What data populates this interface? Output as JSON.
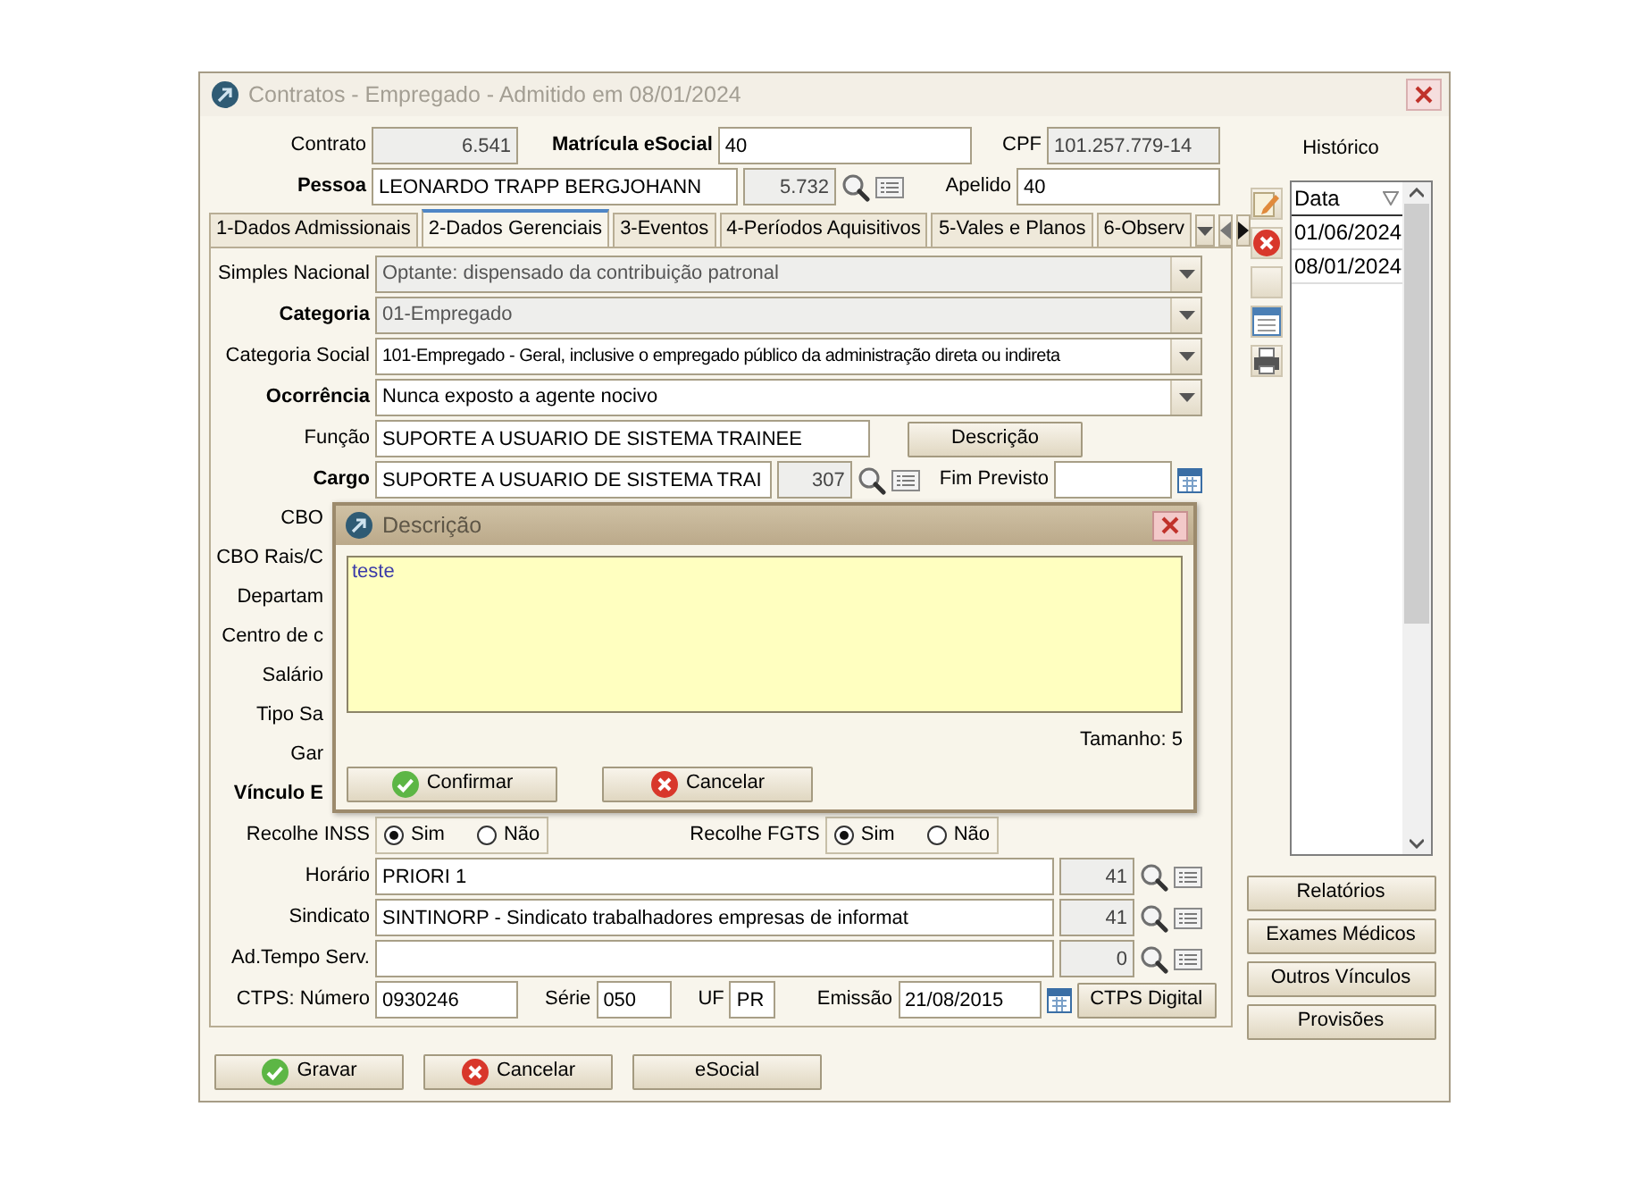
{
  "window": {
    "title": "Contratos - Empregado - Admitido em 08/01/2024"
  },
  "header": {
    "contrato": {
      "label": "Contrato",
      "bold": false,
      "value": "6.541",
      "disabled": true
    },
    "matricula": {
      "label": "Matrícula eSocial",
      "bold": true,
      "value": "40",
      "disabled": false
    },
    "cpf": {
      "label": "CPF",
      "bold": false,
      "value": "101.257.779-14",
      "disabled": true
    },
    "pessoa": {
      "label": "Pessoa",
      "bold": true,
      "value": "LEONARDO TRAPP BERGJOHANN",
      "code": "5.732"
    },
    "apelido": {
      "label": "Apelido",
      "bold": false,
      "value": "40",
      "disabled": false
    }
  },
  "tabs": [
    {
      "label": "1-Dados Admissionais",
      "selected": false
    },
    {
      "label": "2-Dados Gerenciais",
      "selected": true
    },
    {
      "label": "3-Eventos",
      "selected": false
    },
    {
      "label": "4-Períodos Aquisitivos",
      "selected": false
    },
    {
      "label": "5-Vales e Planos",
      "selected": false
    },
    {
      "label": "6-Observ",
      "selected": false
    }
  ],
  "form_rows": [
    {
      "kind": "combo",
      "label": "Simples Nacional",
      "bold": false,
      "value": "Optante: dispensado da contribuição patronal",
      "disabled": true
    },
    {
      "kind": "combo",
      "label": "Categoria",
      "bold": true,
      "value": "01-Empregado",
      "disabled": true
    },
    {
      "kind": "combo",
      "label": "Categoria Social",
      "bold": false,
      "value": "101-Empregado - Geral, inclusive o empregado público da administração direta ou indireta",
      "disabled": false
    },
    {
      "kind": "combo",
      "label": "Ocorrência",
      "bold": true,
      "value": "Nunca exposto a agente nocivo",
      "disabled": false
    },
    {
      "kind": "text_button",
      "label": "Função",
      "bold": false,
      "value": "SUPORTE A USUARIO DE SISTEMA TRAINEE",
      "button": "Descrição"
    },
    {
      "kind": "lookup_date",
      "label": "Cargo",
      "bold": true,
      "value": "SUPORTE A USUARIO DE SISTEMA TRAI",
      "code": "307",
      "date_label": "Fim Previsto"
    },
    {
      "kind": "covered",
      "label": "CBO",
      "bold": false
    },
    {
      "kind": "covered",
      "label": "CBO Rais/C",
      "bold": false
    },
    {
      "kind": "covered",
      "label": "Departam",
      "bold": false
    },
    {
      "kind": "covered",
      "label": "Centro de c",
      "bold": false
    },
    {
      "kind": "covered",
      "label": "Salário",
      "bold": false
    },
    {
      "kind": "covered",
      "label": "Tipo Sa",
      "bold": false
    },
    {
      "kind": "covered",
      "label": "Gar",
      "bold": false
    },
    {
      "kind": "covered",
      "label": "Vínculo E",
      "bold": true
    },
    {
      "kind": "radios",
      "groups": [
        {
          "label": "Recolhe INSS",
          "options": [
            {
              "label": "Sim",
              "selected": true
            },
            {
              "label": "Não",
              "selected": false
            }
          ]
        },
        {
          "label": "Recolhe FGTS",
          "options": [
            {
              "label": "Sim",
              "selected": true
            },
            {
              "label": "Não",
              "selected": false
            }
          ]
        }
      ]
    },
    {
      "kind": "lookup",
      "label": "Horário",
      "bold": false,
      "value": "PRIORI 1",
      "code": "41"
    },
    {
      "kind": "lookup",
      "label": "Sindicato",
      "bold": false,
      "value": "SINTINORP - Sindicato trabalhadores empresas de informat",
      "code": "41"
    },
    {
      "kind": "lookup",
      "label": "Ad.Tempo Serv.",
      "bold": false,
      "code": "0"
    },
    {
      "kind": "ctps",
      "label": "CTPS: Número",
      "bold": false,
      "value": "0930246",
      "fields": [
        {
          "label": "Série",
          "value": "050"
        },
        {
          "label": "UF",
          "value": "PR"
        },
        {
          "label": "Emissão",
          "value": "21/08/2015"
        }
      ],
      "button": "CTPS Digital"
    }
  ],
  "footer_buttons": [
    {
      "label": "Gravar",
      "kind": "confirm"
    },
    {
      "label": "Cancelar",
      "kind": "cancel"
    },
    {
      "label": "eSocial",
      "kind": "plain"
    }
  ],
  "historico": {
    "title": "Histórico",
    "column": "Data",
    "rows": [
      "01/06/2024",
      "08/01/2024"
    ]
  },
  "side_buttons": [
    "Relatórios",
    "Exames Médicos",
    "Outros Vínculos",
    "Provisões"
  ],
  "dialog": {
    "title": "Descrição",
    "text": "teste",
    "size_text": "Tamanho: 5",
    "buttons": [
      {
        "label": "Confirmar",
        "kind": "confirm"
      },
      {
        "label": "Cancelar",
        "kind": "cancel"
      }
    ]
  }
}
